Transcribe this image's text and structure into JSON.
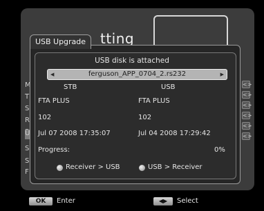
{
  "background": {
    "menu_title_fragment": "tting",
    "side_letters": [
      "M",
      "T",
      "S",
      "R",
      "R",
      "U",
      "S",
      "S",
      "F"
    ],
    "highlighted_index": 5
  },
  "dialog": {
    "tab_title": "USB Upgrade",
    "status_message": "USB disk is attached",
    "selected_file": "ferguson_APP_0704_2.rs232",
    "columns": {
      "stb": {
        "header": "STB",
        "name": "FTA PLUS",
        "version": "102",
        "date": "Jul 07 2008 17:35:07"
      },
      "usb": {
        "header": "USB",
        "name": "FTA PLUS",
        "version": "102",
        "date": "Jul 04 2008 17:29:42"
      }
    },
    "progress_label": "Progress:",
    "progress_value": "0%",
    "progress_fraction": 0,
    "options": [
      {
        "label": "Receiver > USB"
      },
      {
        "label": "USB > Receiver"
      }
    ]
  },
  "footer": {
    "ok_key": "OK",
    "ok_label": "Enter",
    "select_key": "◀▶",
    "select_label": "Select"
  }
}
